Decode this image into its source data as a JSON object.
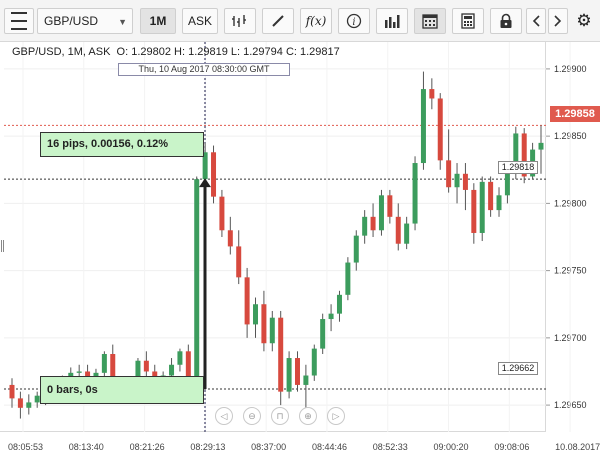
{
  "toolbar": {
    "symbol": "GBP/USD",
    "timeframe": "1M",
    "price_side": "ASK",
    "icons": [
      "menu-icon",
      "candle-type-icon",
      "draw-line-icon",
      "function-icon",
      "info-icon",
      "volume-bars-icon",
      "calendar-icon",
      "calculator-icon",
      "lock-icon",
      "scroll-left-icon",
      "scroll-right-icon",
      "gear-icon"
    ]
  },
  "legend": {
    "text": "GBP/USD, 1M, ASK",
    "ohlc": "O: 1.29802 H: 1.29819 L: 1.29794 C: 1.29817"
  },
  "cursor_date": "Thu, 10 Aug 2017 08:30:00 GMT",
  "measure_label": "16 pips, 0.00156, 0.12%",
  "bars_label": "0 bars, 0s",
  "current_price": "1.29858",
  "crosshair_tags": {
    "upper": "1.29818",
    "lower": "1.29662"
  },
  "colors": {
    "bull": "#3c9c5d",
    "bear": "#d7493e",
    "price_line": "#e05a4e",
    "measure_fill": "#c9f4c9"
  },
  "nav_buttons": [
    "◁",
    "⊖",
    "⊓",
    "⊕",
    "▷"
  ],
  "chart_data": {
    "type": "candlestick",
    "ylim": [
      1.2963,
      1.2992
    ],
    "y_ticks": [
      "1.29900",
      "1.29850",
      "1.29800",
      "1.29750",
      "1.29700",
      "1.29650"
    ],
    "x_tick_labels": [
      "08:05:53",
      "08:13:40",
      "08:21:26",
      "08:29:13",
      "08:37:00",
      "08:44:46",
      "08:52:33",
      "09:00:20",
      "09:08:06",
      "10.08.2017"
    ],
    "candles": [
      [
        1.29665,
        1.2967,
        1.29648,
        1.29655
      ],
      [
        1.29655,
        1.2966,
        1.2964,
        1.29648
      ],
      [
        1.29648,
        1.29658,
        1.29643,
        1.29652
      ],
      [
        1.29652,
        1.2966,
        1.29648,
        1.29657
      ],
      [
        1.29657,
        1.29662,
        1.2965,
        1.29655
      ],
      [
        1.29655,
        1.29663,
        1.29652,
        1.2966
      ],
      [
        1.2966,
        1.29672,
        1.29657,
        1.29668
      ],
      [
        1.29668,
        1.29678,
        1.29662,
        1.29674
      ],
      [
        1.29674,
        1.2968,
        1.2967,
        1.29675
      ],
      [
        1.29675,
        1.2968,
        1.29662,
        1.29667
      ],
      [
        1.29667,
        1.29677,
        1.29662,
        1.29674
      ],
      [
        1.29674,
        1.2969,
        1.2967,
        1.29688
      ],
      [
        1.29688,
        1.29695,
        1.2966,
        1.29665
      ],
      [
        1.29665,
        1.2967,
        1.29655,
        1.29663
      ],
      [
        1.29663,
        1.29668,
        1.29655,
        1.29658
      ],
      [
        1.29658,
        1.29685,
        1.29655,
        1.29683
      ],
      [
        1.29683,
        1.2969,
        1.2967,
        1.29675
      ],
      [
        1.29675,
        1.2968,
        1.29662,
        1.29664
      ],
      [
        1.29664,
        1.29675,
        1.2966,
        1.29672
      ],
      [
        1.29672,
        1.29685,
        1.29668,
        1.2968
      ],
      [
        1.2968,
        1.29692,
        1.29675,
        1.2969
      ],
      [
        1.2969,
        1.29695,
        1.29665,
        1.29668
      ],
      [
        1.29665,
        1.2982,
        1.2966,
        1.29818
      ],
      [
        1.29818,
        1.29845,
        1.2981,
        1.29838
      ],
      [
        1.29838,
        1.29843,
        1.298,
        1.29805
      ],
      [
        1.29805,
        1.2981,
        1.29775,
        1.2978
      ],
      [
        1.2978,
        1.2979,
        1.29762,
        1.29768
      ],
      [
        1.29768,
        1.2978,
        1.2974,
        1.29745
      ],
      [
        1.29745,
        1.29752,
        1.297,
        1.2971
      ],
      [
        1.2971,
        1.2973,
        1.297,
        1.29725
      ],
      [
        1.29725,
        1.29735,
        1.2969,
        1.29696
      ],
      [
        1.29696,
        1.2972,
        1.2969,
        1.29715
      ],
      [
        1.29715,
        1.2972,
        1.2965,
        1.2966
      ],
      [
        1.2966,
        1.2969,
        1.29655,
        1.29685
      ],
      [
        1.29685,
        1.2969,
        1.2966,
        1.29665
      ],
      [
        1.29665,
        1.2968,
        1.29645,
        1.29672
      ],
      [
        1.29672,
        1.29695,
        1.29668,
        1.29692
      ],
      [
        1.29692,
        1.29718,
        1.29688,
        1.29714
      ],
      [
        1.29714,
        1.29725,
        1.29705,
        1.29718
      ],
      [
        1.29718,
        1.29735,
        1.29712,
        1.29732
      ],
      [
        1.29732,
        1.2976,
        1.29728,
        1.29756
      ],
      [
        1.29756,
        1.2978,
        1.2975,
        1.29776
      ],
      [
        1.29776,
        1.29795,
        1.2977,
        1.2979
      ],
      [
        1.2979,
        1.298,
        1.29775,
        1.2978
      ],
      [
        1.2978,
        1.2981,
        1.29776,
        1.29806
      ],
      [
        1.29806,
        1.2981,
        1.29785,
        1.2979
      ],
      [
        1.2979,
        1.298,
        1.29765,
        1.2977
      ],
      [
        1.2977,
        1.2979,
        1.29766,
        1.29785
      ],
      [
        1.29785,
        1.29835,
        1.2978,
        1.2983
      ],
      [
        1.2983,
        1.29898,
        1.29825,
        1.29885
      ],
      [
        1.29885,
        1.29893,
        1.2987,
        1.29878
      ],
      [
        1.29878,
        1.29882,
        1.29825,
        1.29832
      ],
      [
        1.29832,
        1.29855,
        1.29808,
        1.29812
      ],
      [
        1.29812,
        1.2983,
        1.298,
        1.29822
      ],
      [
        1.29822,
        1.2983,
        1.29795,
        1.2981
      ],
      [
        1.2981,
        1.29815,
        1.2977,
        1.29778
      ],
      [
        1.29778,
        1.2982,
        1.29772,
        1.29816
      ],
      [
        1.29816,
        1.2982,
        1.2979,
        1.29795
      ],
      [
        1.29795,
        1.29812,
        1.2979,
        1.29806
      ],
      [
        1.29806,
        1.29828,
        1.298,
        1.29825
      ],
      [
        1.29825,
        1.29857,
        1.29818,
        1.29852
      ],
      [
        1.29852,
        1.29856,
        1.29815,
        1.2982
      ],
      [
        1.2982,
        1.29845,
        1.29818,
        1.2984
      ],
      [
        1.2984,
        1.29858,
        1.29822,
        1.29845
      ]
    ]
  }
}
